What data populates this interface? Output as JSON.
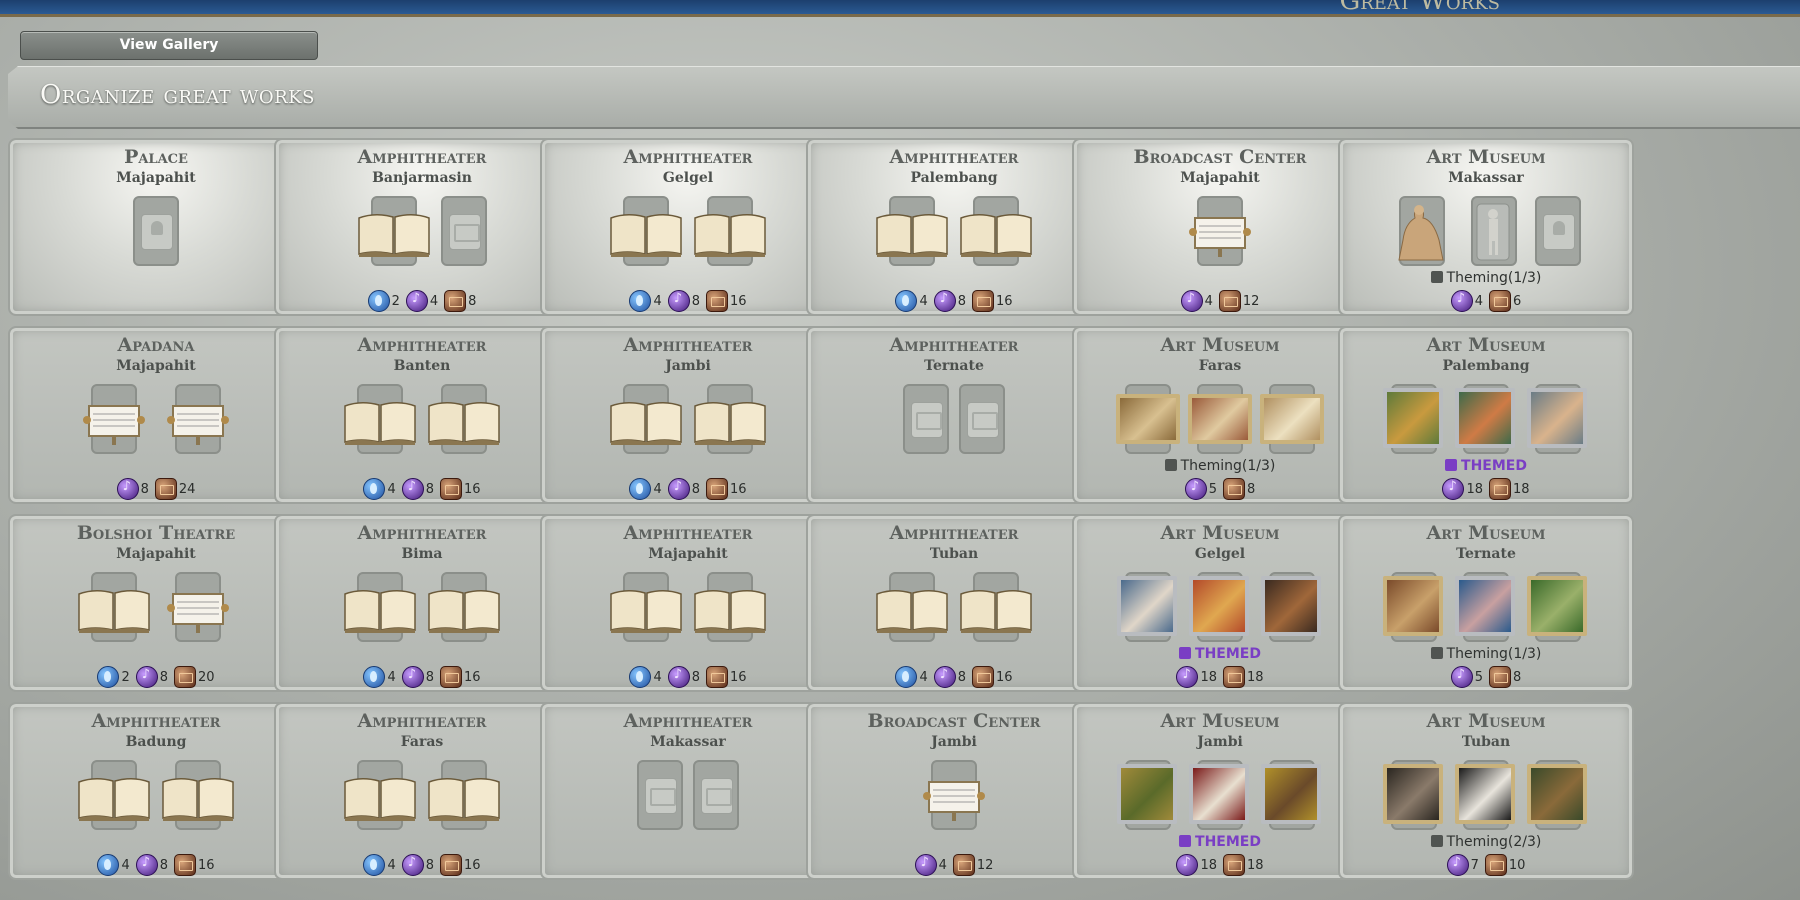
{
  "header": {
    "title_ghost": "Great Works",
    "view_gallery_label": "View Gallery"
  },
  "page_title": "Organize great works",
  "buildings": [
    {
      "name": "Palace",
      "city": "Majapahit",
      "slots": [
        "bust-empty"
      ],
      "theming": "",
      "yields": {
        "science": null,
        "culture": null,
        "tourism": null
      },
      "lit": true
    },
    {
      "name": "Amphitheater",
      "city": "Banjarmasin",
      "slots": [
        "book",
        "book-empty"
      ],
      "theming": "",
      "yields": {
        "science": 2,
        "culture": 4,
        "tourism": 8
      },
      "lit": true
    },
    {
      "name": "Amphitheater",
      "city": "Gelgel",
      "slots": [
        "book",
        "book"
      ],
      "theming": "",
      "yields": {
        "science": 4,
        "culture": 8,
        "tourism": 16
      },
      "lit": true
    },
    {
      "name": "Amphitheater",
      "city": "Palembang",
      "slots": [
        "book",
        "book"
      ],
      "theming": "",
      "yields": {
        "science": 4,
        "culture": 8,
        "tourism": 16
      },
      "lit": true
    },
    {
      "name": "Broadcast Center",
      "city": "Majapahit",
      "slots": [
        "music"
      ],
      "theming": "",
      "yields": {
        "science": null,
        "culture": 4,
        "tourism": 12
      },
      "lit": true
    },
    {
      "name": "Art Museum",
      "city": "Makassar",
      "slots": [
        "sculpt-pieta",
        "sculpt-david",
        "bust-empty"
      ],
      "theming": "Theming(1/3)",
      "yields": {
        "science": null,
        "culture": 4,
        "tourism": 6
      },
      "lit": true
    },
    {
      "name": "Apadana",
      "city": "Majapahit",
      "slots": [
        "music",
        "music"
      ],
      "theming": "",
      "yields": {
        "science": null,
        "culture": 8,
        "tourism": 24
      },
      "lit": false
    },
    {
      "name": "Amphitheater",
      "city": "Banten",
      "slots": [
        "book",
        "book"
      ],
      "theming": "",
      "yields": {
        "science": 4,
        "culture": 8,
        "tourism": 16
      },
      "lit": false
    },
    {
      "name": "Amphitheater",
      "city": "Jambi",
      "slots": [
        "book",
        "book"
      ],
      "theming": "",
      "yields": {
        "science": 4,
        "culture": 8,
        "tourism": 16
      },
      "lit": false
    },
    {
      "name": "Amphitheater",
      "city": "Ternate",
      "slots": [
        "book-empty",
        "book-empty"
      ],
      "theming": "",
      "yields": {
        "science": null,
        "culture": null,
        "tourism": null
      },
      "lit": false
    },
    {
      "name": "Art Museum",
      "city": "Faras",
      "slots": [
        "land-1",
        "land-2",
        "land-3"
      ],
      "theming": "Theming(1/3)",
      "yields": {
        "science": null,
        "culture": 5,
        "tourism": 8
      },
      "lit": false
    },
    {
      "name": "Art Museum",
      "city": "Palembang",
      "slots": [
        "paint-a",
        "paint-b",
        "paint-c"
      ],
      "theming": "THEMED",
      "yields": {
        "science": null,
        "culture": 18,
        "tourism": 18
      },
      "lit": false
    },
    {
      "name": "Bolshoi Theatre",
      "city": "Majapahit",
      "slots": [
        "book",
        "music"
      ],
      "theming": "",
      "yields": {
        "science": 2,
        "culture": 8,
        "tourism": 20
      },
      "lit": false
    },
    {
      "name": "Amphitheater",
      "city": "Bima",
      "slots": [
        "book",
        "book"
      ],
      "theming": "",
      "yields": {
        "science": 4,
        "culture": 8,
        "tourism": 16
      },
      "lit": false
    },
    {
      "name": "Amphitheater",
      "city": "Majapahit",
      "slots": [
        "book",
        "book"
      ],
      "theming": "",
      "yields": {
        "science": 4,
        "culture": 8,
        "tourism": 16
      },
      "lit": false
    },
    {
      "name": "Amphitheater",
      "city": "Tuban",
      "slots": [
        "book",
        "book"
      ],
      "theming": "",
      "yields": {
        "science": 4,
        "culture": 8,
        "tourism": 16
      },
      "lit": false
    },
    {
      "name": "Art Museum",
      "city": "Gelgel",
      "slots": [
        "paint-d",
        "paint-e",
        "paint-f"
      ],
      "theming": "THEMED",
      "yields": {
        "science": null,
        "culture": 18,
        "tourism": 18
      },
      "lit": false
    },
    {
      "name": "Art Museum",
      "city": "Ternate",
      "slots": [
        "paint-g",
        "paint-h",
        "paint-i"
      ],
      "theming": "Theming(1/3)",
      "yields": {
        "science": null,
        "culture": 5,
        "tourism": 8
      },
      "lit": false
    },
    {
      "name": "Amphitheater",
      "city": "Badung",
      "slots": [
        "book",
        "book"
      ],
      "theming": "",
      "yields": {
        "science": 4,
        "culture": 8,
        "tourism": 16
      },
      "lit": false
    },
    {
      "name": "Amphitheater",
      "city": "Faras",
      "slots": [
        "book",
        "book"
      ],
      "theming": "",
      "yields": {
        "science": 4,
        "culture": 8,
        "tourism": 16
      },
      "lit": false
    },
    {
      "name": "Amphitheater",
      "city": "Makassar",
      "slots": [
        "book-empty",
        "book-empty"
      ],
      "theming": "",
      "yields": {
        "science": null,
        "culture": null,
        "tourism": null
      },
      "lit": false
    },
    {
      "name": "Broadcast Center",
      "city": "Jambi",
      "slots": [
        "music"
      ],
      "theming": "",
      "yields": {
        "science": null,
        "culture": 4,
        "tourism": 12
      },
      "lit": false
    },
    {
      "name": "Art Museum",
      "city": "Jambi",
      "slots": [
        "paint-j",
        "paint-k",
        "paint-l"
      ],
      "theming": "THEMED",
      "yields": {
        "science": null,
        "culture": 18,
        "tourism": 18
      },
      "lit": false
    },
    {
      "name": "Art Museum",
      "city": "Tuban",
      "slots": [
        "paint-m",
        "paint-n",
        "paint-o"
      ],
      "theming": "Theming(2/3)",
      "yields": {
        "science": null,
        "culture": 7,
        "tourism": 10
      },
      "lit": false
    }
  ],
  "colors": {
    "themed": "#7a3ec4",
    "science": "#2f6fc4",
    "culture": "#5a2aa0",
    "tourism": "#7a3a22"
  }
}
